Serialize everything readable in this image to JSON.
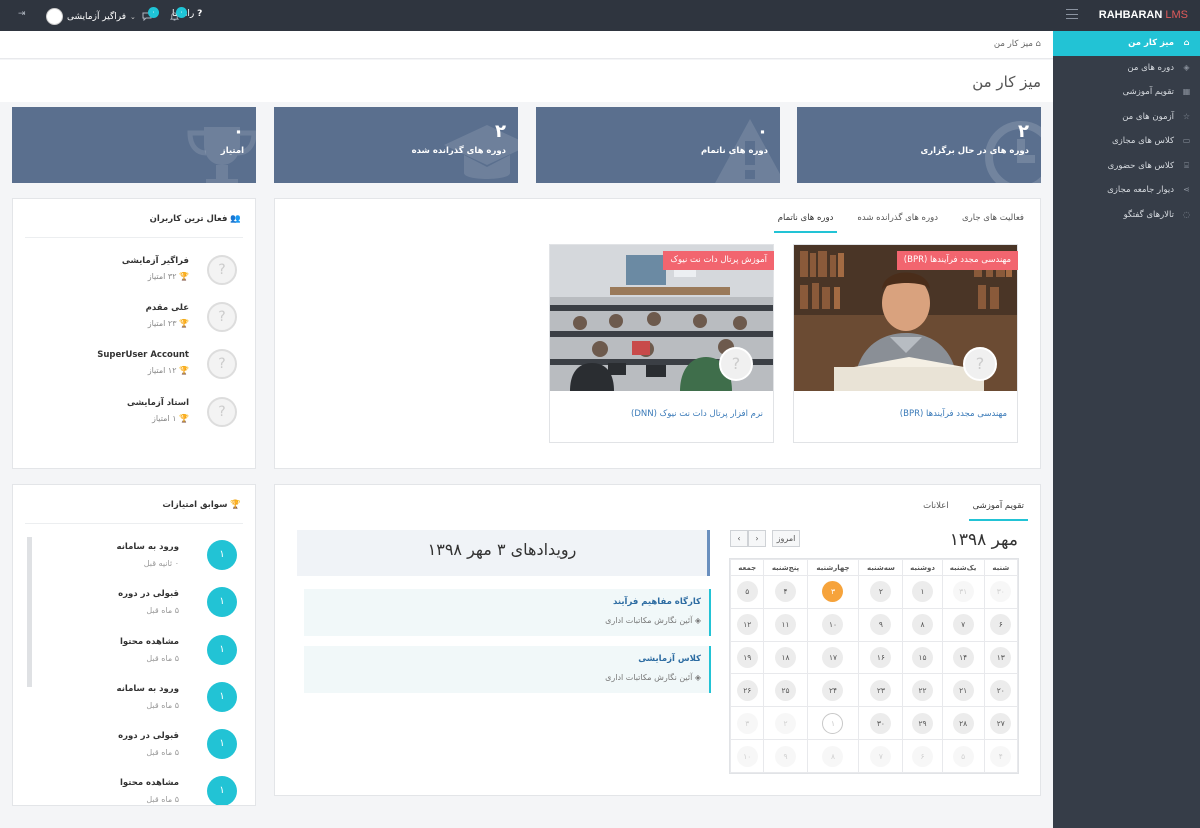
{
  "topbar": {
    "brand_main": "RAHBARAN",
    "brand_suffix": "LMS",
    "user_name": "فراگیر آزمایشی",
    "help_label": "راهنما",
    "notif_count_1": "۰",
    "notif_count_2": "۰"
  },
  "sidebar": {
    "items": [
      {
        "label": "میز کار من",
        "icon": "home-icon"
      },
      {
        "label": "دوره های من",
        "icon": "layers-icon"
      },
      {
        "label": "تقویم آموزشی",
        "icon": "calendar-icon"
      },
      {
        "label": "آزمون های من",
        "icon": "star-icon"
      },
      {
        "label": "کلاس های مجازی",
        "icon": "monitor-icon"
      },
      {
        "label": "کلاس های حضوری",
        "icon": "building-icon"
      },
      {
        "label": "دیوار جامعه مجازی",
        "icon": "share-icon"
      },
      {
        "label": "تالارهای گفتگو",
        "icon": "comments-icon"
      }
    ]
  },
  "breadcrumb": {
    "label": "میز کار من"
  },
  "page": {
    "title": "میز کار من"
  },
  "stats": [
    {
      "value": "۲",
      "label": "دوره های در حال برگزاری",
      "icon": "clock-icon"
    },
    {
      "value": "۰",
      "label": "دوره های ناتمام",
      "icon": "warning-icon"
    },
    {
      "value": "۲",
      "label": "دوره های گذرانده شده",
      "icon": "graduation-cap-icon"
    },
    {
      "value": "۰",
      "label": "امتیاز",
      "icon": "trophy-icon"
    }
  ],
  "courses_panel": {
    "tabs": [
      "فعالیت های جاری",
      "دوره های گذرانده شده",
      "دوره های ناتمام"
    ],
    "active_tab": "دوره های ناتمام",
    "courses": [
      {
        "tag": "مهندسی مجدد فرآیندها (BPR)",
        "title": "مهندسی مجدد فرآیندها (BPR)"
      },
      {
        "tag": "آموزش پرتال دات نت نیوک",
        "title": "نرم افزار پرتال دات نت نیوک (DNN)"
      }
    ]
  },
  "top_users": {
    "title": "فعال ترین کاربران",
    "users": [
      {
        "name": "فراگیر آزمایشی",
        "points": "۳۲ امتیاز"
      },
      {
        "name": "علی مقدم",
        "points": "۲۳ امتیاز"
      },
      {
        "name": "SuperUser Account",
        "points": "۱۲ امتیاز"
      },
      {
        "name": "استاد آزمایشی",
        "points": "۱ امتیاز"
      }
    ]
  },
  "calendar_panel": {
    "tabs": [
      "تقویم آموزشی",
      "اعلانات"
    ],
    "active_tab": "تقویم آموزشی",
    "month_title": "مهر ۱۳۹۸",
    "today_label": "امروز",
    "weekdays": [
      "شنبه",
      "یک‌شنبه",
      "دوشنبه",
      "سه‌شنبه",
      "چهارشنبه",
      "پنج‌شنبه",
      "جمعه"
    ],
    "weeks": [
      [
        "۳۰",
        "۳۱",
        "۱",
        "۲",
        "۳",
        "۴",
        "۵"
      ],
      [
        "۶",
        "۷",
        "۸",
        "۹",
        "۱۰",
        "۱۱",
        "۱۲"
      ],
      [
        "۱۳",
        "۱۴",
        "۱۵",
        "۱۶",
        "۱۷",
        "۱۸",
        "۱۹"
      ],
      [
        "۲۰",
        "۲۱",
        "۲۲",
        "۲۳",
        "۲۴",
        "۲۵",
        "۲۶"
      ],
      [
        "۲۷",
        "۲۸",
        "۲۹",
        "۳۰",
        "۱",
        "۲",
        "۳"
      ],
      [
        "۴",
        "۵",
        "۶",
        "۷",
        "۸",
        "۹",
        "۱۰"
      ]
    ],
    "events_title": "رویدادهای ۳ مهر ۱۳۹۸",
    "events": [
      {
        "name": "کارگاه مفاهیم فرآیند",
        "course": "آئین نگارش مکاتبات اداری"
      },
      {
        "name": "کلاس آزمایشی",
        "course": "آئین نگارش مکاتبات اداری"
      }
    ]
  },
  "points_history": {
    "title": "سوابق امتیازات",
    "items": [
      {
        "badge": "۱",
        "title": "ورود به سامانه",
        "time": "۰ ثانیه قبل"
      },
      {
        "badge": "۱",
        "title": "قبولی در دوره",
        "time": "۵ ماه قبل"
      },
      {
        "badge": "۱",
        "title": "مشاهده محتوا",
        "time": "۵ ماه قبل"
      },
      {
        "badge": "۱",
        "title": "ورود به سامانه",
        "time": "۵ ماه قبل"
      },
      {
        "badge": "۱",
        "title": "قبولی در دوره",
        "time": "۵ ماه قبل"
      },
      {
        "badge": "۱",
        "title": "مشاهده محتوا",
        "time": "۵ ماه قبل"
      }
    ]
  }
}
